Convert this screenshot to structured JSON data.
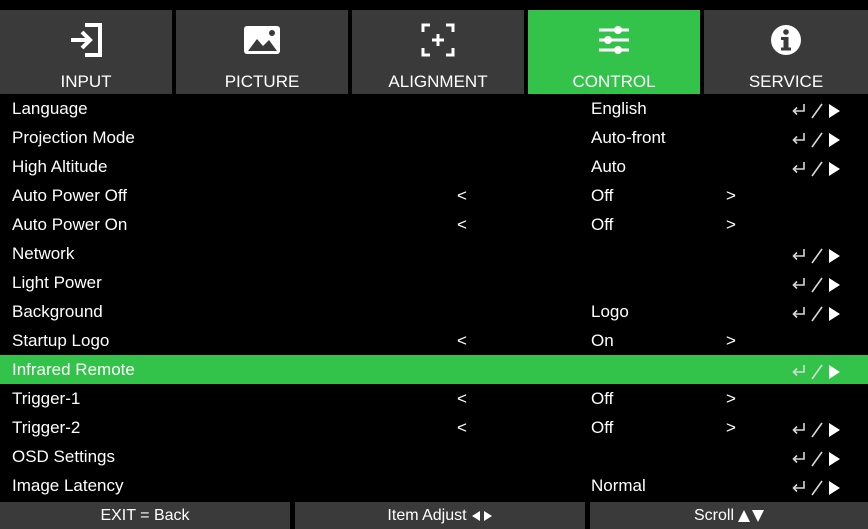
{
  "tabs": [
    {
      "label": "INPUT",
      "icon": "input-icon",
      "active": false
    },
    {
      "label": "PICTURE",
      "icon": "picture-icon",
      "active": false
    },
    {
      "label": "ALIGNMENT",
      "icon": "alignment-icon",
      "active": false
    },
    {
      "label": "CONTROL",
      "icon": "sliders-icon",
      "active": true
    },
    {
      "label": "SERVICE",
      "icon": "info-icon",
      "active": false
    }
  ],
  "rows": [
    {
      "name": "Language",
      "value": "English",
      "left": "",
      "right": "",
      "action": true
    },
    {
      "name": "Projection Mode",
      "value": "Auto-front",
      "left": "",
      "right": "",
      "action": true
    },
    {
      "name": "High Altitude",
      "value": "Auto",
      "left": "",
      "right": "",
      "action": true
    },
    {
      "name": "Auto Power Off",
      "value": "Off",
      "left": "<",
      "right": ">",
      "action": false
    },
    {
      "name": "Auto Power On",
      "value": "Off",
      "left": "<",
      "right": ">",
      "action": false
    },
    {
      "name": "Network",
      "value": "",
      "left": "",
      "right": "",
      "action": true
    },
    {
      "name": "Light Power",
      "value": "",
      "left": "",
      "right": "",
      "action": true
    },
    {
      "name": "Background",
      "value": "Logo",
      "left": "",
      "right": "",
      "action": true
    },
    {
      "name": "Startup Logo",
      "value": "On",
      "left": "<",
      "right": ">",
      "action": false
    },
    {
      "name": "Infrared Remote",
      "value": "",
      "left": "",
      "right": "",
      "action": true,
      "selected": true
    },
    {
      "name": "Trigger-1",
      "value": "Off",
      "left": "<",
      "right": ">",
      "action": false
    },
    {
      "name": "Trigger-2",
      "value": "Off",
      "left": "<",
      "right": ">",
      "action": true
    },
    {
      "name": "OSD Settings",
      "value": "",
      "left": "",
      "right": "",
      "action": true
    },
    {
      "name": "Image Latency",
      "value": "Normal",
      "left": "",
      "right": "",
      "action": true
    }
  ],
  "footer": {
    "back": "EXIT = Back",
    "adjust": "Item Adjust",
    "scroll": "Scroll"
  },
  "colors": {
    "accent": "#33c34a",
    "tab_bg": "#3a3a3a",
    "background": "#000000"
  }
}
